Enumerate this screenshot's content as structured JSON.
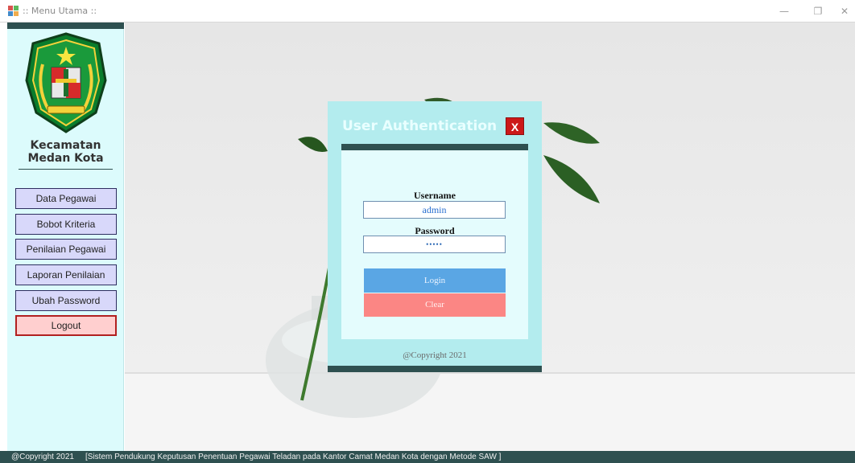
{
  "window": {
    "title": ":: Menu Utama ::",
    "controls": {
      "minimize": "—",
      "maximize": "❐",
      "close": "✕"
    }
  },
  "sidebar": {
    "district_line1": "Kecamatan",
    "district_line2": "Medan Kota",
    "emblem_icon": "kota-medan-emblem-icon",
    "items": [
      {
        "label": "Data Pegawai"
      },
      {
        "label": "Bobot Kriteria"
      },
      {
        "label": "Penilaian Pegawai"
      },
      {
        "label": "Laporan Penilaian"
      },
      {
        "label": "Ubah Password"
      },
      {
        "label": "Logout"
      }
    ]
  },
  "dialog": {
    "title": "User Authentication",
    "close_label": "X",
    "username_label": "Username",
    "username_value": "admin",
    "password_label": "Password",
    "password_value": "•••••",
    "login_label": "Login",
    "clear_label": "Clear",
    "copyright": "@Copyright 2021"
  },
  "statusbar": {
    "copyright": "@Copyright 2021",
    "description": "[Sistem Pendukung Keputusan Penentuan Pegawai Teladan pada Kantor Camat Medan Kota dengan Metode SAW ]"
  },
  "colors": {
    "accent_dark": "#2e5050",
    "sidebar_bg": "#dcfbfc",
    "dialog_bg": "#b3ecee",
    "login_button": "#5aa6e4",
    "clear_button": "#fb8684",
    "close_button": "#cc1818",
    "logout_bg": "#ffcfcf"
  }
}
